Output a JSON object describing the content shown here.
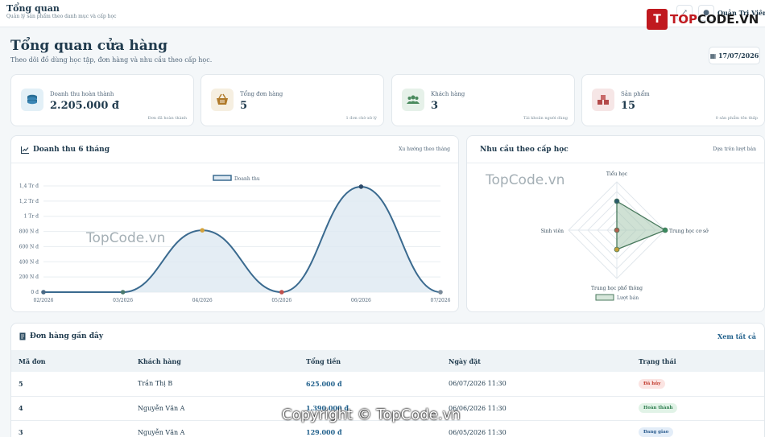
{
  "topbar": {
    "title": "Tổng quan",
    "subtitle": "Quản lý sản phẩm theo danh mục và cấp học",
    "user_name": "Quản Trị Viên"
  },
  "logo": {
    "mark": "T",
    "text_a": "TOP",
    "text_b": "CODE.VN"
  },
  "page": {
    "title": "Tổng quan cửa hàng",
    "subtitle": "Theo dõi đồ dùng học tập, đơn hàng và nhu cầu theo cấp học.",
    "date": "17/07/2026"
  },
  "kpis": [
    {
      "label": "Doanh thu hoàn thành",
      "value": "2.205.000 đ",
      "note": "Đơn đã hoàn thành",
      "icon": "coins-icon",
      "color": "#2a6f97",
      "bg": "#e3f0f7"
    },
    {
      "label": "Tổng đơn hàng",
      "value": "5",
      "note": "1 đơn chờ xử lý",
      "icon": "basket-icon",
      "color": "#b07a2a",
      "bg": "#f6efe1"
    },
    {
      "label": "Khách hàng",
      "value": "3",
      "note": "Tài khoản người dùng",
      "icon": "users-icon",
      "color": "#4a8a5e",
      "bg": "#e6f1e9"
    },
    {
      "label": "Sản phẩm",
      "value": "15",
      "note": "0 sản phẩm tồn thấp",
      "icon": "boxes-icon",
      "color": "#b34a4a",
      "bg": "#f6e6e6"
    }
  ],
  "revenue": {
    "title": "Doanh thu 6 tháng",
    "right": "Xu hướng theo tháng"
  },
  "demand": {
    "title": "Nhu cầu theo cấp học",
    "right": "Dựa trên lượt bán"
  },
  "chart_data": [
    {
      "type": "line",
      "x": [
        "02/2026",
        "03/2026",
        "04/2026",
        "05/2026",
        "06/2026",
        "07/2026"
      ],
      "series": [
        {
          "name": "Doanh thu",
          "values": [
            0,
            0,
            815000,
            0,
            1390000,
            0
          ]
        }
      ],
      "yticks": [
        "0 đ",
        "200 N đ",
        "400 N đ",
        "600 N đ",
        "800 N đ",
        "1 Tr đ",
        "1,2 Tr đ",
        "1,4 Tr đ"
      ],
      "ylim": [
        0,
        1400000
      ],
      "point_colors": [
        "#4a6a86",
        "#4a7a6e",
        "#d4a23a",
        "#c0504d",
        "#2c4a6a",
        "#7a8a9a"
      ],
      "line_color": "#3a6a8f",
      "fill_color": "#dde8f1",
      "legend": "top",
      "grid": true
    },
    {
      "type": "radar",
      "categories": [
        "Tiểu học",
        "Trung học cơ sở",
        "Trung học phổ thông",
        "Sinh viên"
      ],
      "series": [
        {
          "name": "Lượt bán",
          "values": [
            3,
            5,
            2,
            0
          ]
        }
      ],
      "rmax": 5,
      "point_colors": [
        "#2c5a6a",
        "#3a8a5e",
        "#c4a03a",
        "#b0604d"
      ],
      "line_color": "#4a7a5e",
      "fill_color": "#a8c8b0",
      "legend": "bottom"
    }
  ],
  "orders": {
    "title": "Đơn hàng gần đây",
    "view_all": "Xem tất cả",
    "headers": [
      "Mã đơn",
      "Khách hàng",
      "Tổng tiền",
      "Ngày đặt",
      "Trạng thái"
    ],
    "rows": [
      {
        "id": "5",
        "customer": "Trần Thị B",
        "total": "625.000 đ",
        "date": "06/07/2026 11:30",
        "status": "Đã hủy",
        "fg": "#c0392b",
        "bg": "#fbe4e2"
      },
      {
        "id": "4",
        "customer": "Nguyễn Văn A",
        "total": "1.390.000 đ",
        "date": "06/06/2026 11:30",
        "status": "Hoàn thành",
        "fg": "#2e7d4f",
        "bg": "#e1f3e7"
      },
      {
        "id": "3",
        "customer": "Nguyễn Văn A",
        "total": "129.000 đ",
        "date": "06/05/2026 11:30",
        "status": "Đang giao",
        "fg": "#2c5d8f",
        "bg": "#e3edf8"
      }
    ]
  },
  "watermarks": [
    "TopCode.vn",
    "TopCode.vn"
  ],
  "copyright": "Copyright © TopCode.vn"
}
